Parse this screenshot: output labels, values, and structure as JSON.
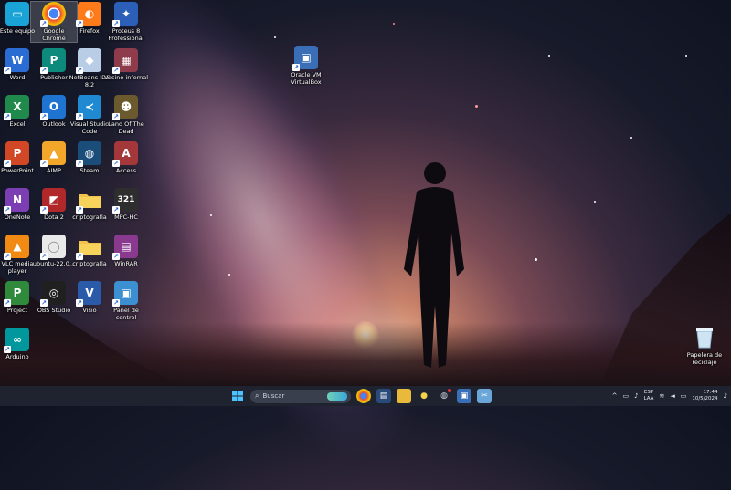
{
  "desktop": {
    "icons": [
      {
        "label": "Este equipo",
        "color": "#1aa3d6",
        "glyph": "▭",
        "icon": "computer-icon"
      },
      {
        "label": "Google Chrome",
        "color": "#ffffff",
        "glyph": "◉",
        "icon": "chrome-icon"
      },
      {
        "label": "Firefox",
        "color": "#ff7a18",
        "glyph": "◐",
        "icon": "firefox-icon"
      },
      {
        "label": "Proteus 8 Professional",
        "color": "#2b5fb8",
        "glyph": "✦",
        "icon": "proteus-icon"
      },
      {
        "label": "Word",
        "color": "#2b6cd4",
        "glyph": "W",
        "icon": "word-icon"
      },
      {
        "label": "Publisher",
        "color": "#0e8a7d",
        "glyph": "P",
        "icon": "publisher-icon"
      },
      {
        "label": "NetBeans IDE 8.2",
        "color": "#b9cde6",
        "glyph": "◆",
        "icon": "netbeans-icon"
      },
      {
        "label": "Vecino infernal",
        "color": "#8e3b4b",
        "glyph": "▦",
        "icon": "game-icon"
      },
      {
        "label": "Excel",
        "color": "#1f8a4c",
        "glyph": "X",
        "icon": "excel-icon"
      },
      {
        "label": "Outlook",
        "color": "#1e74d0",
        "glyph": "O",
        "icon": "outlook-icon"
      },
      {
        "label": "Visual Studio Code",
        "color": "#1f8ad2",
        "glyph": "≺",
        "icon": "vscode-icon"
      },
      {
        "label": "Land Of The Dead",
        "color": "#6b5a2e",
        "glyph": "☻",
        "icon": "game-icon"
      },
      {
        "label": "PowerPoint",
        "color": "#d24726",
        "glyph": "P",
        "icon": "powerpoint-icon"
      },
      {
        "label": "AIMP",
        "color": "#f2a62a",
        "glyph": "▲",
        "icon": "aimp-icon"
      },
      {
        "label": "Steam",
        "color": "#1b4d7a",
        "glyph": "◍",
        "icon": "steam-icon"
      },
      {
        "label": "Access",
        "color": "#a4373a",
        "glyph": "A",
        "icon": "access-icon"
      },
      {
        "label": "OneNote",
        "color": "#7b3fb3",
        "glyph": "N",
        "icon": "onenote-icon"
      },
      {
        "label": "Dota 2",
        "color": "#b0282a",
        "glyph": "◩",
        "icon": "dota-icon"
      },
      {
        "label": "criptografia",
        "color": "#e8b93a",
        "glyph": "",
        "icon": "folder-icon"
      },
      {
        "label": "MPC-HC",
        "color": "#2e2e2e",
        "glyph": "321",
        "icon": "mpc-icon"
      },
      {
        "label": "VLC media player",
        "color": "#f08a12",
        "glyph": "▲",
        "icon": "vlc-icon"
      },
      {
        "label": "ubuntu-22.0...",
        "color": "#e9e9e9",
        "glyph": "◯",
        "icon": "disc-image-icon"
      },
      {
        "label": "criptografia",
        "color": "#e8b93a",
        "glyph": "",
        "icon": "folder-icon"
      },
      {
        "label": "WinRAR",
        "color": "#8a3a8e",
        "glyph": "▤",
        "icon": "winrar-icon"
      },
      {
        "label": "Project",
        "color": "#2f8a3c",
        "glyph": "P",
        "icon": "project-icon"
      },
      {
        "label": "OBS Studio",
        "color": "#202020",
        "glyph": "◎",
        "icon": "obs-icon"
      },
      {
        "label": "Visio",
        "color": "#2a5aa8",
        "glyph": "V",
        "icon": "visio-icon"
      },
      {
        "label": "Panel de control",
        "color": "#3c8fd0",
        "glyph": "▣",
        "icon": "control-panel-icon"
      },
      {
        "label": "Arduino",
        "color": "#00979d",
        "glyph": "∞",
        "icon": "arduino-icon"
      }
    ],
    "virtualbox": {
      "label": "Oracle VM VirtualBox",
      "color": "#3a6fb8"
    },
    "recycle": {
      "label": "Papelera de reciclaje"
    }
  },
  "taskbar": {
    "search_placeholder": "Buscar",
    "apps": [
      "start",
      "search",
      "chrome",
      "file-explorer",
      "folder",
      "chat",
      "steam-app",
      "virtualbox-app",
      "snipping-app"
    ],
    "lang_top": "ESP",
    "lang_bottom": "LAA",
    "time": "17:44",
    "date": "10/5/2024",
    "chevron": "^"
  }
}
